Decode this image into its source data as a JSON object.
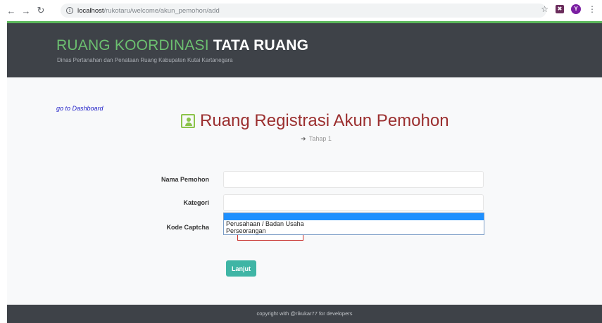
{
  "browser": {
    "url_host": "localhost",
    "url_path": "/rukotaru/welcome/akun_pemohon/add",
    "profile_initial": "Y"
  },
  "header": {
    "title_light": "RUANG KOORDINASI ",
    "title_bold": "TATA RUANG",
    "subtitle": "Dinas Pertanahan dan Penataan Ruang Kabupaten Kutai Kartanegara"
  },
  "main": {
    "dashboard_link": "go to Dashboard",
    "page_title": "Ruang Registrasi Akun Pemohon",
    "step": "Tahap 1"
  },
  "form": {
    "nama_label": "Nama Pemohon",
    "nama_value": "",
    "kategori_label": "Kategori",
    "kategori_value": "",
    "captcha_label": "Kode Captcha",
    "kategori_options": [
      "",
      "Perusahaan / Badan Usaha",
      "Perseorangan"
    ],
    "submit_label": "Lanjut"
  },
  "footer": {
    "copyright": "copyright with @rikukar77 for developers"
  },
  "colors": {
    "header_bg": "#3e4248",
    "accent_green": "#6cc070",
    "title_red": "#9b2f2f",
    "button_teal": "#3fb5a5",
    "selected_blue": "#1e90ff"
  }
}
